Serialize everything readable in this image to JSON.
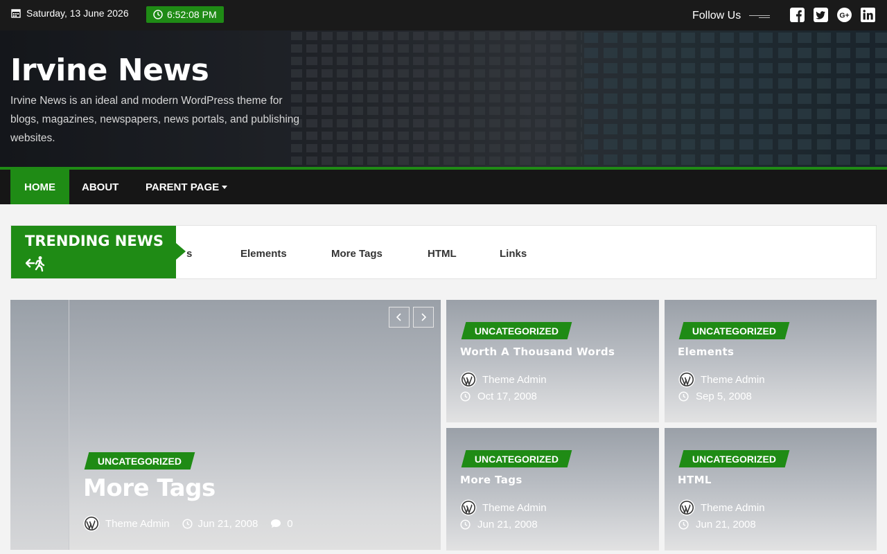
{
  "topbar": {
    "date": "Saturday, 13 June 2026",
    "time": "6:52:08 PM",
    "follow_label": "Follow Us",
    "social_icons": [
      "facebook-icon",
      "twitter-icon",
      "google-plus-icon",
      "linkedin-icon"
    ]
  },
  "header": {
    "title": "Irvine News",
    "description": "Irvine News is an ideal and modern WordPress theme for blogs, magazines, newspapers, news portals, and publishing websites."
  },
  "nav": {
    "items": [
      {
        "label": "HOME",
        "active": true
      },
      {
        "label": "ABOUT"
      },
      {
        "label": "PARENT PAGE",
        "has_dropdown": true
      }
    ]
  },
  "trending": {
    "label": "TRENDING NEWS",
    "partial_item": "s",
    "items": [
      "Elements",
      "More Tags",
      "HTML",
      "Links"
    ]
  },
  "featured": {
    "category": "UNCATEGORIZED",
    "title": "More Tags",
    "author": "Theme Admin",
    "date": "Jun 21, 2008",
    "comments": "0"
  },
  "cards": [
    {
      "category": "UNCATEGORIZED",
      "title": "Worth A Thousand Words",
      "author": "Theme Admin",
      "date": "Oct 17, 2008"
    },
    {
      "category": "UNCATEGORIZED",
      "title": "Elements",
      "author": "Theme Admin",
      "date": "Sep 5, 2008"
    },
    {
      "category": "UNCATEGORIZED",
      "title": "More Tags",
      "author": "Theme Admin",
      "date": "Jun 21, 2008"
    },
    {
      "category": "UNCATEGORIZED",
      "title": "HTML",
      "author": "Theme Admin",
      "date": "Jun 21, 2008"
    }
  ],
  "colors": {
    "accent": "#1f8b15",
    "topbar": "#1a1a1a",
    "nav": "#161616"
  }
}
